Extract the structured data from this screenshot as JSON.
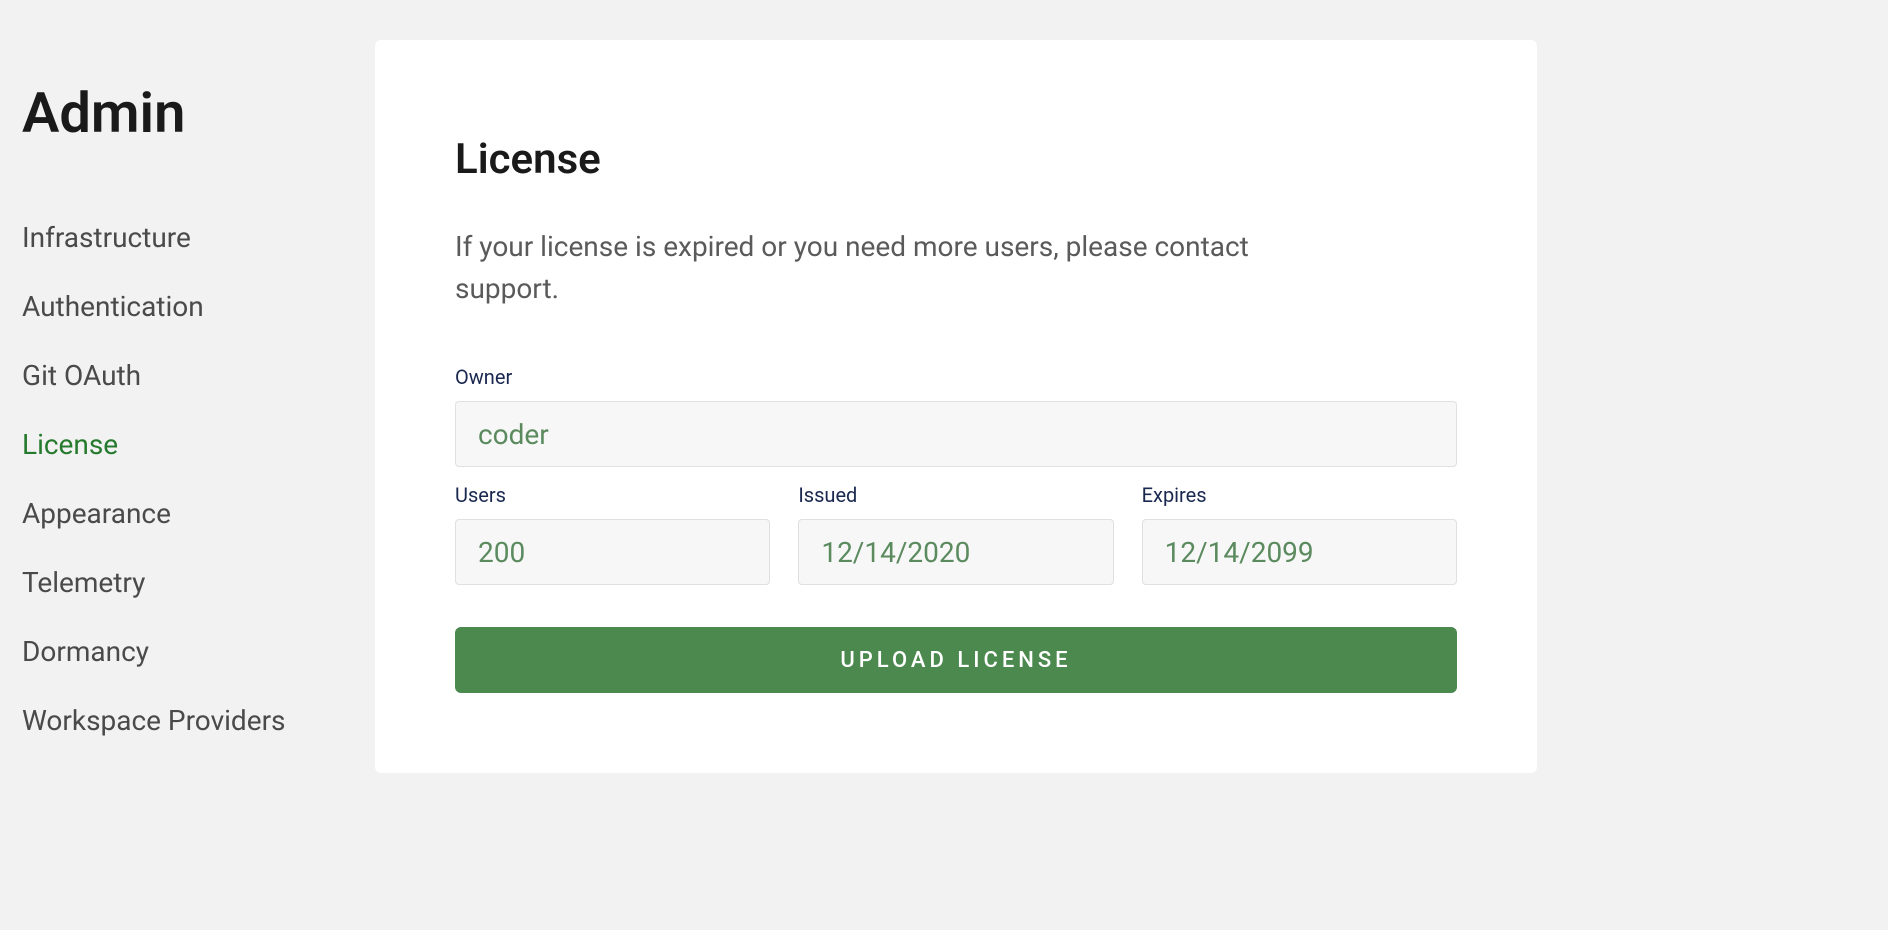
{
  "sidebar": {
    "title": "Admin",
    "items": [
      {
        "label": "Infrastructure",
        "active": false
      },
      {
        "label": "Authentication",
        "active": false
      },
      {
        "label": "Git OAuth",
        "active": false
      },
      {
        "label": "License",
        "active": true
      },
      {
        "label": "Appearance",
        "active": false
      },
      {
        "label": "Telemetry",
        "active": false
      },
      {
        "label": "Dormancy",
        "active": false
      },
      {
        "label": "Workspace Providers",
        "active": false
      }
    ]
  },
  "main": {
    "title": "License",
    "subtitle": "If your license is expired or you need more users, please contact support.",
    "fields": {
      "owner": {
        "label": "Owner",
        "value": "coder"
      },
      "users": {
        "label": "Users",
        "value": "200"
      },
      "issued": {
        "label": "Issued",
        "value": "12/14/2020"
      },
      "expires": {
        "label": "Expires",
        "value": "12/14/2099"
      }
    },
    "upload_button": "UPLOAD LICENSE"
  }
}
